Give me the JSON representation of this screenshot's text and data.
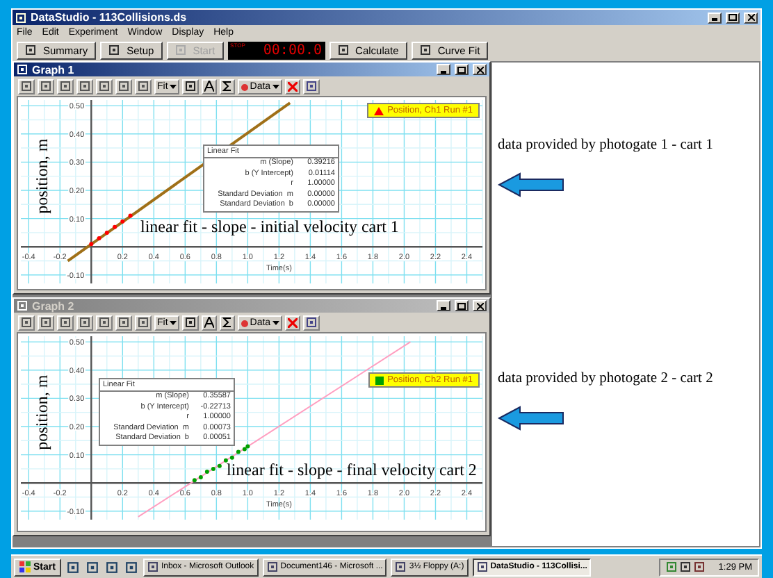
{
  "window": {
    "title": "DataStudio - 113Collisions.ds"
  },
  "menu": [
    "File",
    "Edit",
    "Experiment",
    "Window",
    "Display",
    "Help"
  ],
  "toolbar": [
    {
      "kind": "button",
      "label": "Summary",
      "disabled": false
    },
    {
      "kind": "button",
      "label": "Setup",
      "disabled": false
    },
    {
      "kind": "button",
      "label": "Start",
      "disabled": true
    },
    {
      "kind": "timer",
      "label": "STOP",
      "value": "00:00.0"
    },
    {
      "kind": "button",
      "label": "Calculate",
      "disabled": false
    },
    {
      "kind": "button",
      "label": "Curve Fit",
      "disabled": false
    }
  ],
  "graphs": [
    {
      "title": "Graph 1",
      "active": true,
      "tools": {
        "fit": "Fit",
        "data": "Data"
      },
      "legend": {
        "kind": "triangle"
      },
      "fit": {
        "rows": [
          {
            "label": "m (Slope)",
            "value": "0.39216"
          },
          {
            "label": "b (Y Intercept)",
            "value": "0.01114"
          },
          {
            "label": "r",
            "value": "1.00000"
          },
          {
            "label": "Standard Deviation  m",
            "value": "0.00000"
          },
          {
            "label": "Standard Deviation  b",
            "value": "0.00000"
          }
        ]
      },
      "note": "linear fit - slope - initial velocity cart 1",
      "chart_data": {
        "type": "line",
        "grid": true,
        "xlabel": "Time(s)",
        "ylabel": "position, m",
        "xlim": [
          -0.45,
          2.5
        ],
        "ylim": [
          -0.13,
          0.52
        ],
        "xticks": [
          {
            "value": -0.4,
            "label": "-0.4"
          },
          {
            "value": -0.2,
            "label": "-0.2"
          },
          {
            "value": 0.2,
            "label": "0.2"
          },
          {
            "value": 0.4,
            "label": "0.4"
          },
          {
            "value": 0.6,
            "label": "0.6"
          },
          {
            "value": 0.8,
            "label": "0.8"
          },
          {
            "value": 1,
            "label": "1.0"
          },
          {
            "value": 1.2,
            "label": "1.2"
          },
          {
            "value": 1.4,
            "label": "1.4"
          },
          {
            "value": 1.6,
            "label": "1.6"
          },
          {
            "value": 1.8,
            "label": "1.8"
          },
          {
            "value": 2,
            "label": "2.0"
          },
          {
            "value": 2.2,
            "label": "2.2"
          },
          {
            "value": 2.4,
            "label": "2.4"
          }
        ],
        "yticks": [
          {
            "value": -0.1,
            "label": "-0.10"
          },
          {
            "value": 0.1,
            "label": "0.10"
          },
          {
            "value": 0.2,
            "label": "0.20"
          },
          {
            "value": 0.3,
            "label": "0.30"
          },
          {
            "value": 0.4,
            "label": "0.40"
          },
          {
            "value": 0.5,
            "label": "0.50"
          }
        ],
        "series": [
          {
            "name": "Linear Fit",
            "type": "line",
            "color": "#a07018",
            "x": [
              -0.15,
              1.27
            ],
            "values": [
              -0.05,
              0.51
            ]
          },
          {
            "name": "Position, Ch1 Run #1",
            "type": "scatter",
            "color": "#ff0000",
            "x": [
              0,
              0.05,
              0.1,
              0.15,
              0.2,
              0.25
            ],
            "values": [
              0.01,
              0.03,
              0.05,
              0.07,
              0.09,
              0.11
            ]
          }
        ]
      }
    },
    {
      "title": "Graph 2",
      "active": false,
      "tools": {
        "fit": "Fit",
        "data": "Data"
      },
      "legend": {
        "kind": "square"
      },
      "fit": {
        "rows": [
          {
            "label": "m (Slope)",
            "value": "0.35587"
          },
          {
            "label": "b (Y Intercept)",
            "value": "-0.22713"
          },
          {
            "label": "r",
            "value": "1.00000"
          },
          {
            "label": "Standard Deviation  m",
            "value": "0.00073"
          },
          {
            "label": "Standard Deviation  b",
            "value": "0.00051"
          }
        ]
      },
      "note": "linear fit - slope - final velocity cart 2",
      "chart_data": {
        "type": "line",
        "grid": true,
        "xlabel": "Time(s)",
        "ylabel": "position, m",
        "xlim": [
          -0.45,
          2.5
        ],
        "ylim": [
          -0.13,
          0.52
        ],
        "xticks": [
          {
            "value": -0.4,
            "label": "-0.4"
          },
          {
            "value": -0.2,
            "label": "-0.2"
          },
          {
            "value": 0.2,
            "label": "0.2"
          },
          {
            "value": 0.4,
            "label": "0.4"
          },
          {
            "value": 0.6,
            "label": "0.6"
          },
          {
            "value": 0.8,
            "label": "0.8"
          },
          {
            "value": 1,
            "label": "1.0"
          },
          {
            "value": 1.2,
            "label": "1.2"
          },
          {
            "value": 1.4,
            "label": "1.4"
          },
          {
            "value": 1.6,
            "label": "1.6"
          },
          {
            "value": 1.8,
            "label": "1.8"
          },
          {
            "value": 2,
            "label": "2.0"
          },
          {
            "value": 2.2,
            "label": "2.2"
          },
          {
            "value": 2.4,
            "label": "2.4"
          }
        ],
        "yticks": [
          {
            "value": -0.1,
            "label": "-0.10"
          },
          {
            "value": 0.1,
            "label": "0.10"
          },
          {
            "value": 0.2,
            "label": "0.20"
          },
          {
            "value": 0.3,
            "label": "0.30"
          },
          {
            "value": 0.4,
            "label": "0.40"
          },
          {
            "value": 0.5,
            "label": "0.50"
          }
        ],
        "series": [
          {
            "name": "Linear Fit",
            "type": "line",
            "color": "#ff9ec0",
            "x": [
              0.3,
              2.04
            ],
            "values": [
              -0.12,
              0.5
            ]
          },
          {
            "name": "Position, Ch2 Run #1",
            "type": "scatter",
            "color": "#00a000",
            "x": [
              0.66,
              0.7,
              0.74,
              0.78,
              0.82,
              0.86,
              0.9,
              0.94,
              0.98,
              1.0
            ],
            "values": [
              0.01,
              0.02,
              0.04,
              0.05,
              0.06,
              0.08,
              0.09,
              0.11,
              0.12,
              0.13
            ]
          }
        ]
      }
    }
  ],
  "notes": [
    "data provided by photogate 1 - cart 1",
    "data provided by photogate 2 - cart 2"
  ],
  "taskbar": {
    "start": "Start",
    "tasks": [
      {
        "label": "Inbox - Microsoft Outlook",
        "selected": false
      },
      {
        "label": "Document146 - Microsoft ...",
        "selected": false
      },
      {
        "label": "3½ Floppy (A:)",
        "selected": false
      },
      {
        "label": "DataStudio - 113Collisi...",
        "selected": true
      }
    ],
    "time": "1:29 PM"
  }
}
